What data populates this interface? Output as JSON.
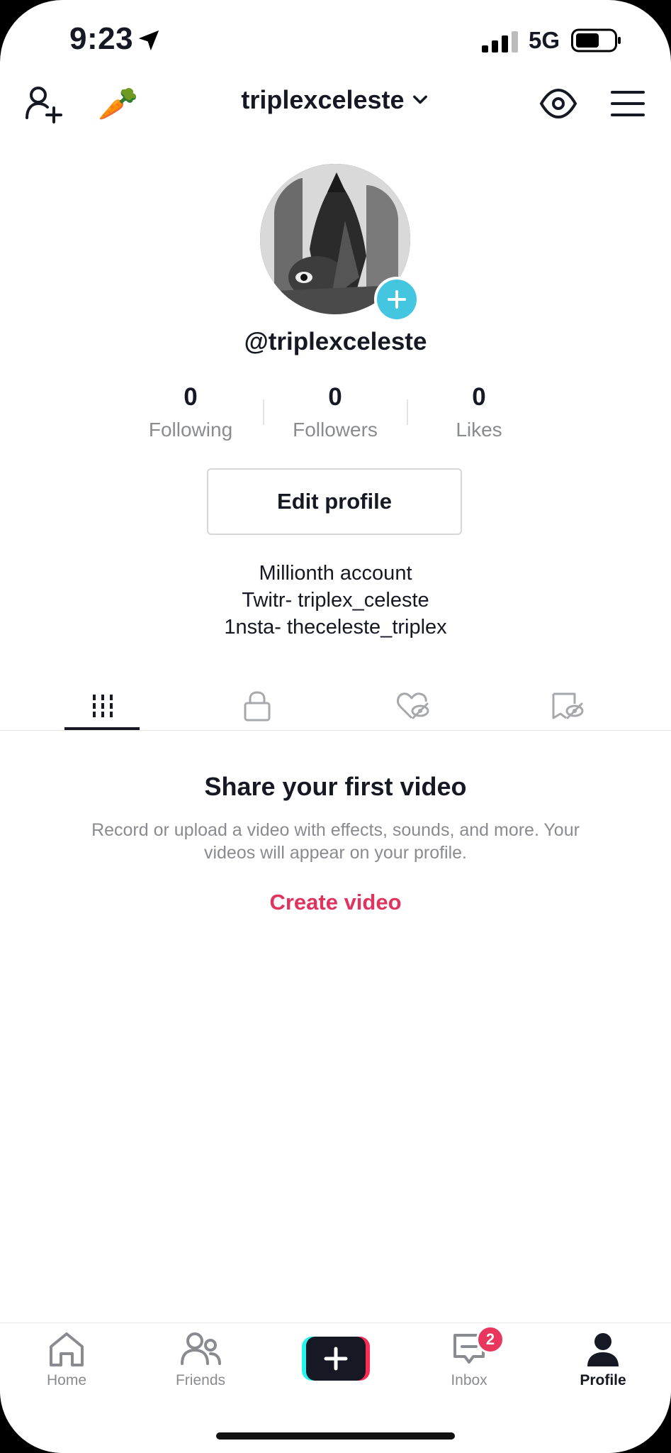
{
  "status_bar": {
    "time": "9:23",
    "network": "5G"
  },
  "header": {
    "username": "triplexceleste",
    "emoji": "🥕"
  },
  "profile": {
    "handle": "@triplexceleste",
    "stats": [
      {
        "value": "0",
        "label": "Following"
      },
      {
        "value": "0",
        "label": "Followers"
      },
      {
        "value": "0",
        "label": "Likes"
      }
    ],
    "edit_label": "Edit profile",
    "bio": [
      "Millionth account",
      "Twitr- triplex_celeste",
      "1nsta- theceleste_triplex"
    ]
  },
  "tabs": [
    "videos-grid-icon",
    "lock-icon",
    "liked-hidden-icon",
    "favorites-hidden-icon"
  ],
  "empty_state": {
    "title": "Share your first video",
    "description": "Record or upload a video with effects, sounds, and more. Your videos will appear on your profile.",
    "cta": "Create video"
  },
  "nav": {
    "home": "Home",
    "friends": "Friends",
    "inbox": "Inbox",
    "inbox_badge": "2",
    "profile": "Profile"
  },
  "colors": {
    "accent": "#e0345f",
    "cyan": "#45c6e0",
    "badge": "#e8365d",
    "text": "#161823",
    "muted": "#8a8b91"
  }
}
